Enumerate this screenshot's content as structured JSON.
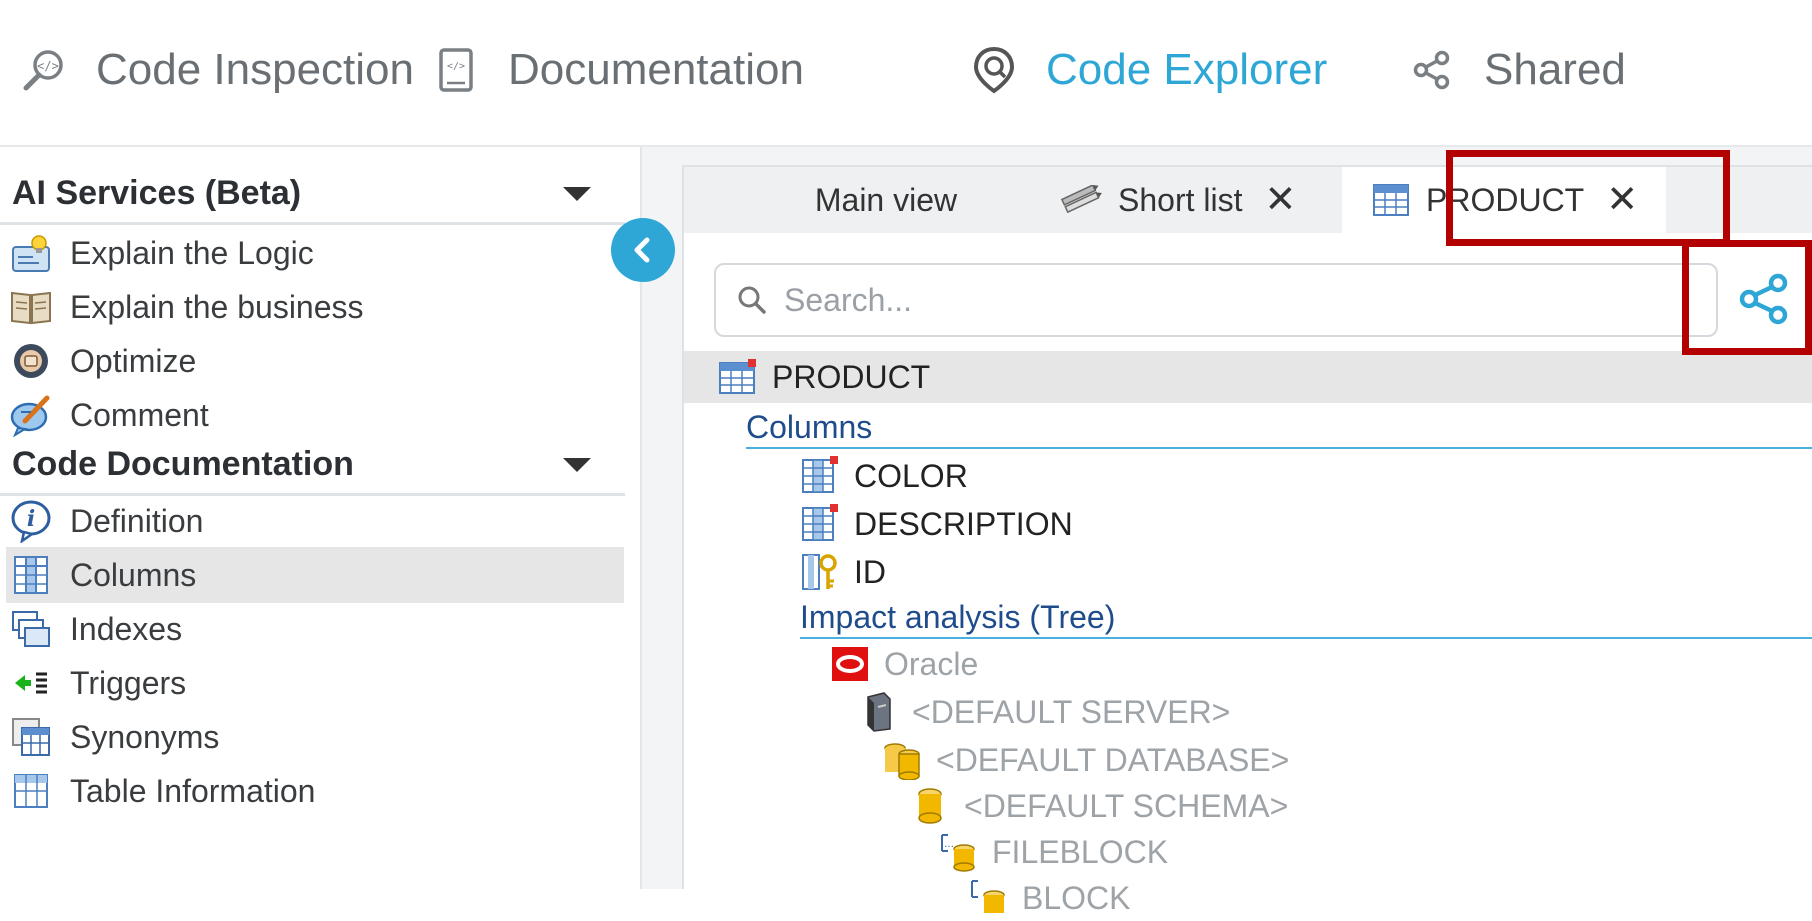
{
  "nav": {
    "items": [
      {
        "label": "Code Inspection",
        "icon": "code-inspection-icon"
      },
      {
        "label": "Documentation",
        "icon": "documentation-icon"
      },
      {
        "label": "Code Explorer",
        "icon": "code-explorer-icon"
      },
      {
        "label": "Shared",
        "icon": "share-icon"
      }
    ],
    "active": "Code Explorer",
    "active_color": "#2ea7d6"
  },
  "sidebar": {
    "ai_section": {
      "title": "AI Services (Beta)",
      "items": [
        {
          "label": "Explain the Logic",
          "icon": "lightbulb-icon"
        },
        {
          "label": "Explain the business",
          "icon": "book-icon"
        },
        {
          "label": "Optimize",
          "icon": "optimize-icon"
        },
        {
          "label": "Comment",
          "icon": "comment-pen-icon"
        }
      ]
    },
    "doc_section": {
      "title": "Code Documentation",
      "items": [
        {
          "label": "Definition",
          "icon": "info-icon"
        },
        {
          "label": "Columns",
          "icon": "columns-icon",
          "selected": true
        },
        {
          "label": "Indexes",
          "icon": "indexes-icon"
        },
        {
          "label": "Triggers",
          "icon": "triggers-icon"
        },
        {
          "label": "Synonyms",
          "icon": "synonyms-icon"
        },
        {
          "label": "Table Information",
          "icon": "table-info-icon"
        }
      ]
    }
  },
  "tabs": [
    {
      "label": "Main view",
      "closable": false
    },
    {
      "label": "Short list",
      "closable": true,
      "icon": "pencils-icon"
    },
    {
      "label": "PRODUCT",
      "closable": true,
      "icon": "table-icon",
      "active": true
    }
  ],
  "tab_close_glyph": "✕",
  "search": {
    "placeholder": "Search..."
  },
  "tree": {
    "root": "PRODUCT",
    "columns_label": "Columns",
    "columns": [
      "COLOR",
      "DESCRIPTION",
      "ID"
    ],
    "impact_label": "Impact analysis (Tree)",
    "impact": [
      {
        "label": "Oracle",
        "icon": "oracle-icon"
      },
      {
        "label": "<DEFAULT SERVER>",
        "icon": "server-icon"
      },
      {
        "label": "<DEFAULT DATABASE>",
        "icon": "database-icon"
      },
      {
        "label": "<DEFAULT SCHEMA>",
        "icon": "schema-icon"
      },
      {
        "label": "FILEBLOCK",
        "icon": "fileblock-icon"
      },
      {
        "label": "BLOCK",
        "icon": "block-icon"
      }
    ]
  },
  "colors": {
    "accent": "#2ea7d6",
    "highlight_box": "#b30000",
    "section_label": "#1f4d8c"
  }
}
